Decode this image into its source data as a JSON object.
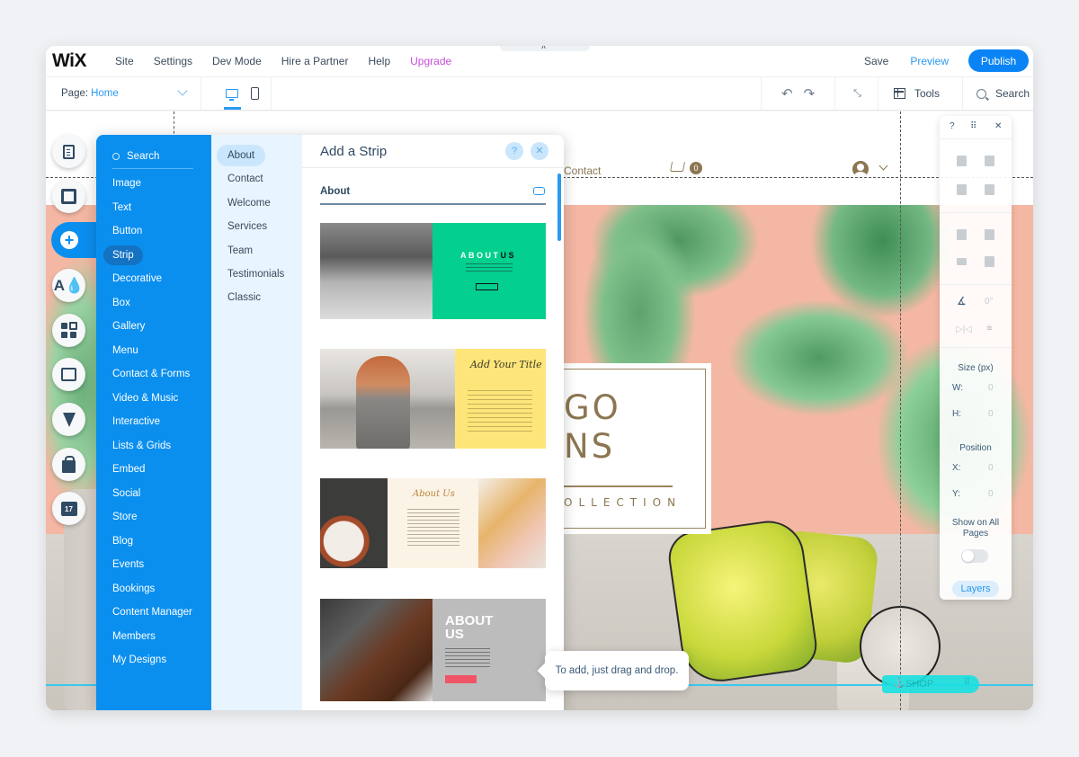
{
  "topbar": {
    "logo": "WiX",
    "menu": [
      "Site",
      "Settings",
      "Dev Mode",
      "Hire a Partner",
      "Help",
      "Upgrade"
    ],
    "save": "Save",
    "preview": "Preview",
    "publish": "Publish",
    "collapse_glyph": "˄"
  },
  "pagebar": {
    "page_label": "Page:",
    "page_value": "Home",
    "undo_icon": "↶",
    "redo_icon": "↷",
    "zoom_out_icon": "⤡",
    "tools": "Tools",
    "search": "Search"
  },
  "rail": {
    "items": [
      "pages",
      "background",
      "add",
      "theme",
      "add-apps",
      "media",
      "blog-pen",
      "store",
      "bookings"
    ],
    "calendar_day": "17",
    "theme_glyph": "A",
    "add_glyph": "+"
  },
  "add_panel": {
    "search_placeholder": "Search",
    "categories": [
      "Image",
      "Text",
      "Button",
      "Strip",
      "Decorative",
      "Box",
      "Gallery",
      "Menu",
      "Contact & Forms",
      "Video & Music",
      "Interactive",
      "Lists & Grids",
      "Embed",
      "Social",
      "Store",
      "Blog",
      "Events",
      "Bookings",
      "Content Manager",
      "Members",
      "My Designs"
    ],
    "selected_category": "Strip",
    "subcategories": [
      "About",
      "Contact",
      "Welcome",
      "Services",
      "Team",
      "Testimonials",
      "Classic"
    ],
    "selected_subcategory": "About",
    "title": "Add a Strip",
    "help": "?",
    "close": "✕",
    "section": "About",
    "thumbs": {
      "t1_title_a": "ABOUT",
      "t1_title_b": "US",
      "t2_title": "Add Your Title",
      "t3_title": "About Us",
      "t4_title": "ABOUT US"
    }
  },
  "tooltip": "To add, just drag and drop.",
  "site": {
    "nav_contact": "Contact",
    "cart_count": "0",
    "hero_title": "GO\nNS",
    "hero_title_line1": "GO",
    "hero_title_line2": "NS",
    "hero_subtitle": "OLLECTION",
    "anchor_label": "SHOP",
    "anchor_icon": "⚓",
    "grip": "⠿"
  },
  "inspector": {
    "help": "?",
    "drag": "⠿",
    "close": "✕",
    "rotate_value": "0°",
    "size_label": "Size (px)",
    "w_label": "W:",
    "w_value": "0",
    "h_label": "H:",
    "h_value": "0",
    "position_label": "Position",
    "x_label": "X:",
    "x_value": "0",
    "y_label": "Y:",
    "y_value": "0",
    "show_all_pages": "Show on All Pages",
    "show_all_pages_on": false,
    "layers": "Layers"
  },
  "colors": {
    "accent": "#0a8fef",
    "upgrade": "#c44fd9",
    "site_gold": "#8c7651",
    "anchor": "#19e1e1"
  }
}
